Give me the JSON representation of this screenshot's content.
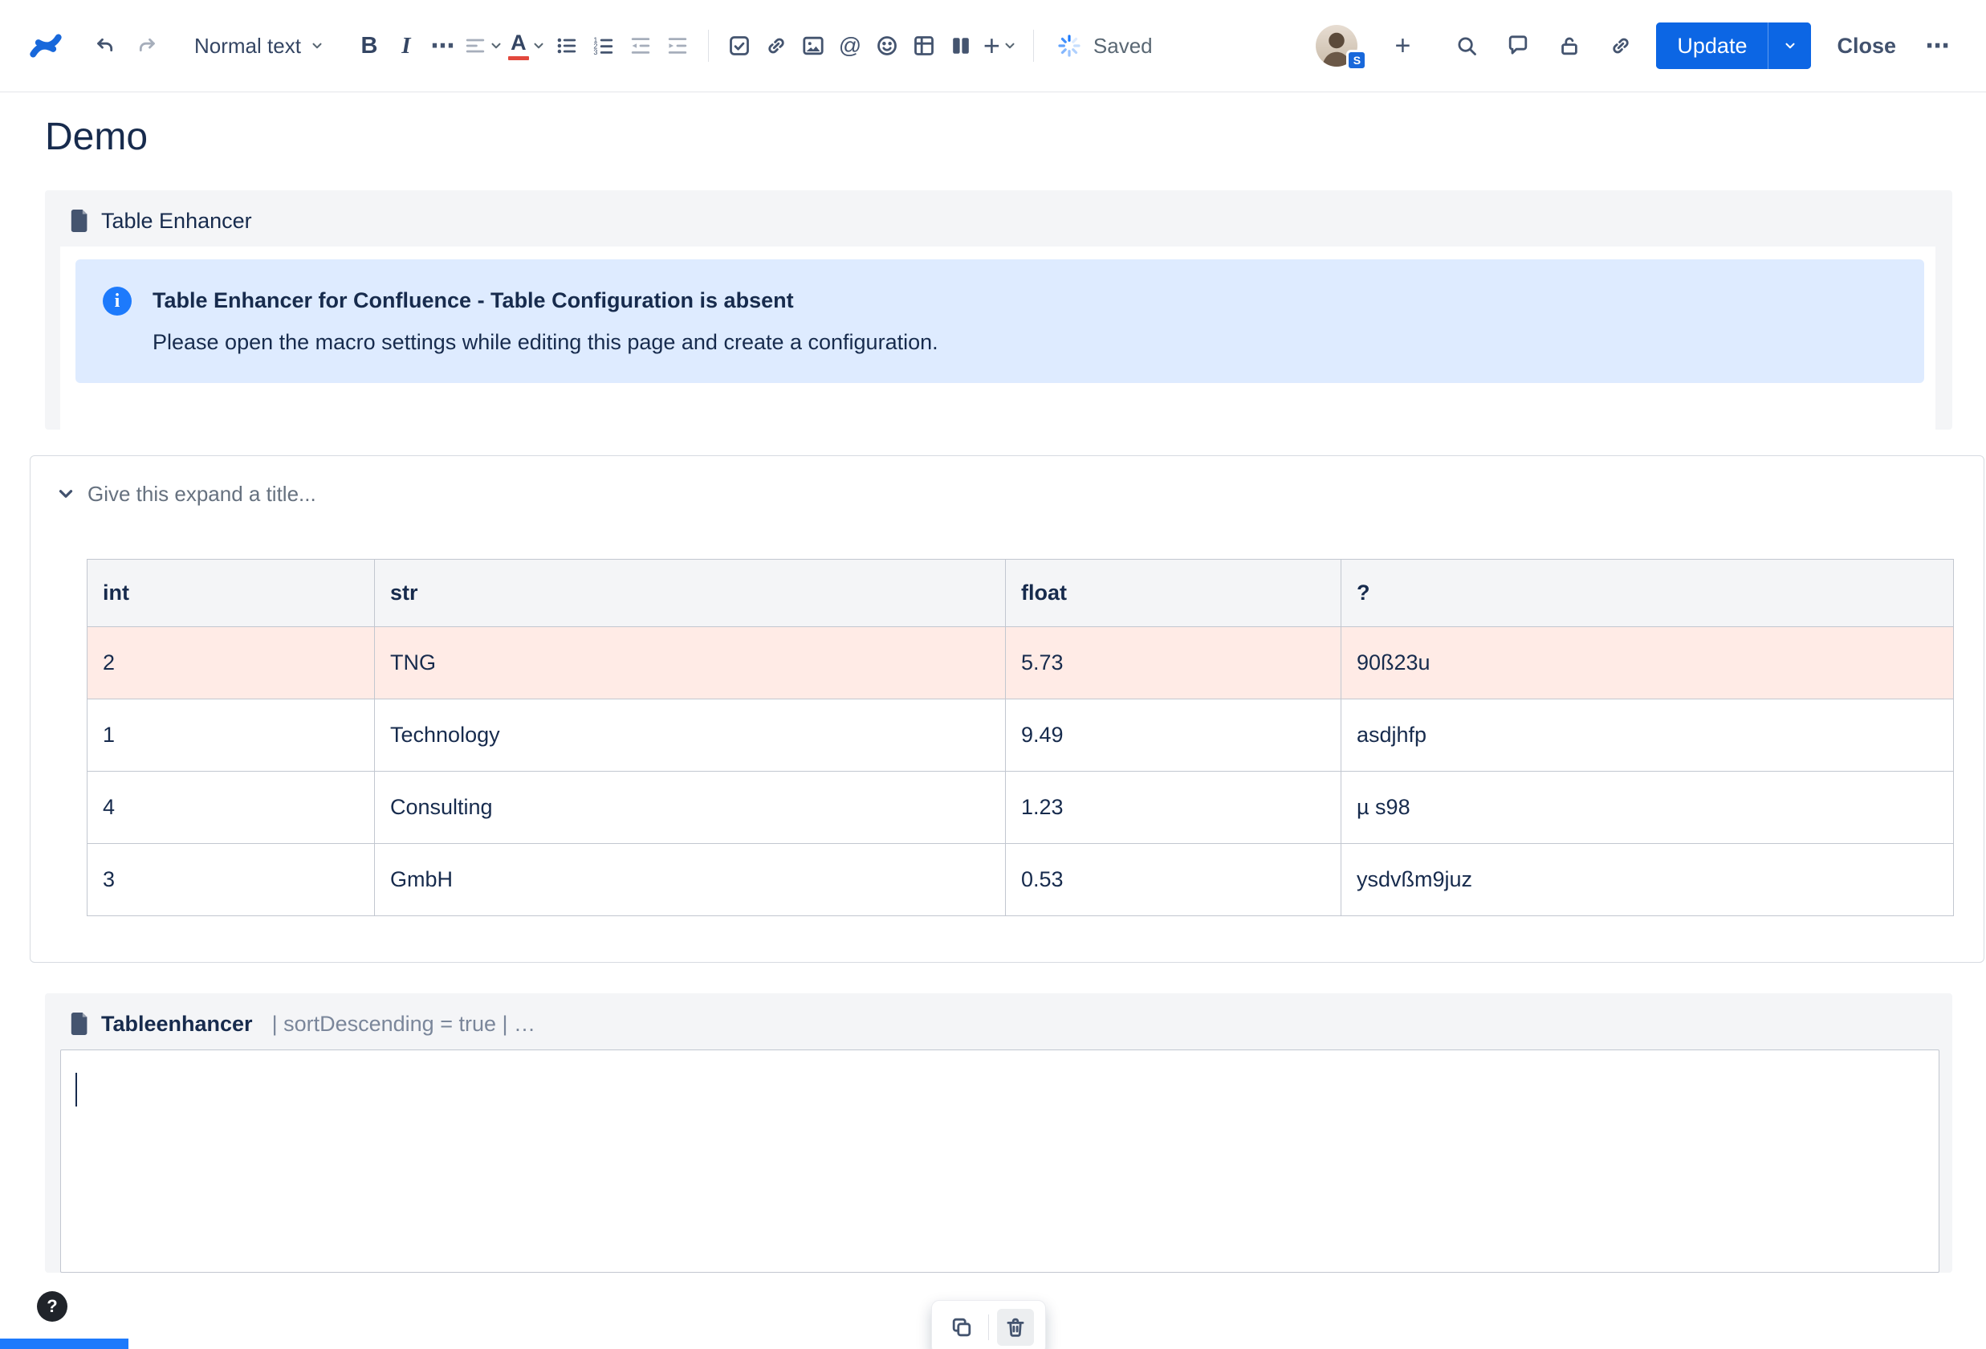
{
  "toolbar": {
    "text_style_label": "Normal text",
    "bold_label": "B",
    "italic_label": "I",
    "more_label": "⋯",
    "text_color_label": "A",
    "mention_label": "@",
    "plus_label": "+",
    "saved_label": "Saved",
    "avatar_badge": "S",
    "collab_add_label": "+",
    "update_label": "Update",
    "close_label": "Close",
    "overflow_label": "⋯"
  },
  "page": {
    "title": "Demo"
  },
  "table_enhancer_macro": {
    "title": "Table Enhancer",
    "info": {
      "title": "Table Enhancer for Confluence - Table Configuration is absent",
      "body": "Please open the macro settings while editing this page and create a configuration."
    }
  },
  "expand": {
    "title_placeholder": "Give this expand a title...",
    "table": {
      "headers": [
        "int",
        "str",
        "float",
        "?"
      ],
      "rows": [
        {
          "cells": [
            "2",
            "TNG",
            "5.73",
            "90ß23u"
          ],
          "highlight": true
        },
        {
          "cells": [
            "1",
            "Technology",
            "9.49",
            "asdjhfp"
          ],
          "highlight": false
        },
        {
          "cells": [
            "4",
            "Consulting",
            "1.23",
            "µ s98"
          ],
          "highlight": false
        },
        {
          "cells": [
            "3",
            "GmbH",
            "0.53",
            "ysdvßm9juz"
          ],
          "highlight": false
        }
      ]
    }
  },
  "tableenhancer_macro": {
    "title": "Tableenhancer",
    "params": "| sortDescending = true | …"
  },
  "help_label": "?",
  "colors": {
    "accent_blue": "#0c66e4",
    "info_panel_bg": "#deebff",
    "highlight_row_bg": "#ffebe6"
  }
}
